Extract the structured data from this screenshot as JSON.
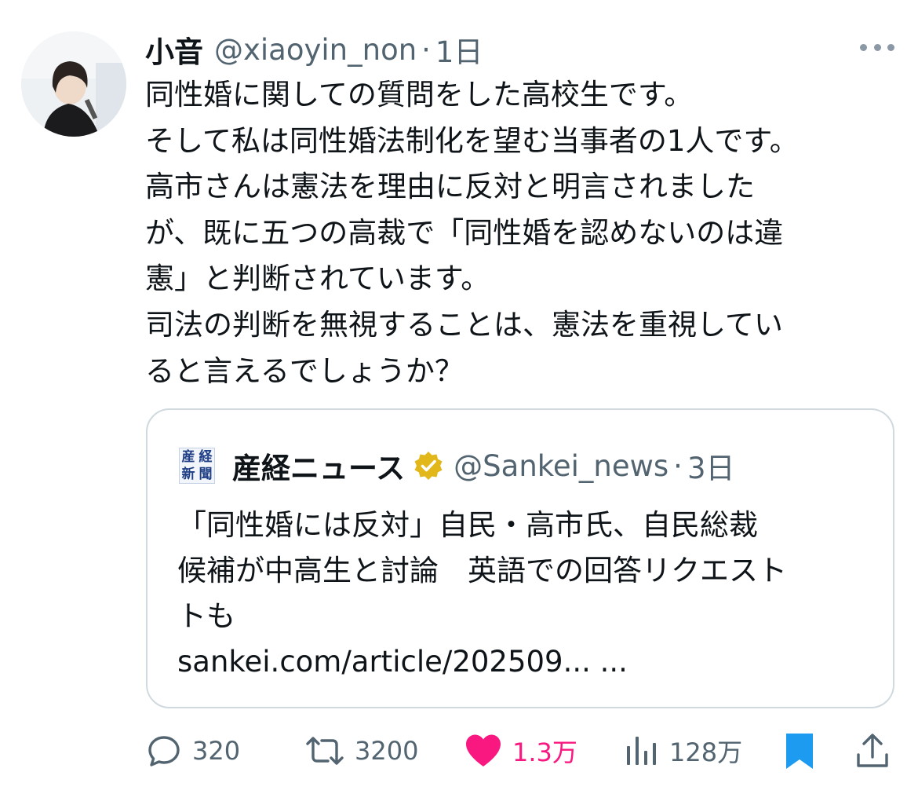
{
  "tweet": {
    "author_name": "小音",
    "handle": "@xiaoyin_non",
    "separator": "·",
    "time": "1日",
    "text_lines": [
      "同性婚に関しての質問をした高校生です。",
      "そして私は同性婚法制化を望む当事者の1人です。",
      "高市さんは憲法を理由に反対と明言されました",
      "が、既に五つの高裁で「同性婚を認めないのは違",
      "憲」と判断されています。",
      "司法の判断を無視することは、憲法を重視してい",
      "ると言えるでしょうか？"
    ]
  },
  "quote": {
    "logo_glyphs": [
      "新",
      "産",
      "聞",
      "経"
    ],
    "author_name": "産経ニュース",
    "handle": "@Sankei_news",
    "separator": "·",
    "time": "3日",
    "text_lines": [
      "「同性婚には反対」自民・高市氏、自民総裁",
      "候補が中高生と討論　英語での回答リクエスト",
      "トも",
      "sankei.com/article/202509... ..."
    ]
  },
  "actions": {
    "reply_count": "320",
    "retweet_count": "3200",
    "like_count": "1.3万",
    "view_count": "128万"
  },
  "colors": {
    "text": "#0f1419",
    "secondary": "#536471",
    "like": "#f91880",
    "bookmark": "#1d9bf0",
    "verified_gold": "#e2b719",
    "border": "#cfd9de"
  },
  "icons": {
    "reply": "reply-bubble-icon",
    "retweet": "retweet-icon",
    "like": "heart-filled-icon",
    "views": "views-bar-chart-icon",
    "bookmark": "bookmark-filled-icon",
    "share": "share-upload-icon",
    "more": "more-dots-icon",
    "verified": "verified-gold-badge-icon"
  }
}
